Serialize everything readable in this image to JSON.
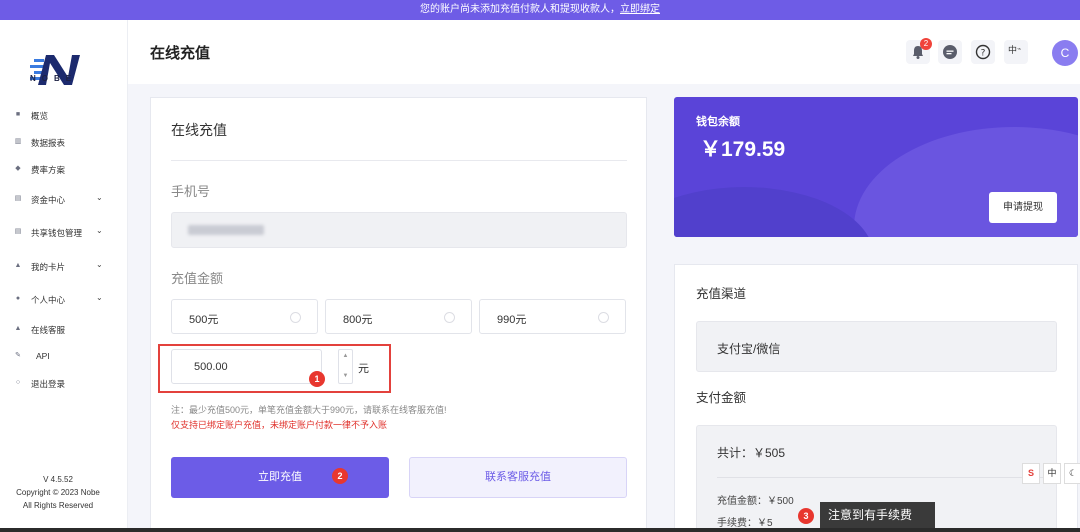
{
  "banner": {
    "text": "您的账户尚未添加充值付款人和提现收款人，",
    "link": "立即绑定"
  },
  "brand": {
    "logo_text": "NOBE"
  },
  "sidebar": {
    "items": [
      {
        "label": "概览",
        "icon": "home-icon"
      },
      {
        "label": "数据报表",
        "icon": "chart-icon"
      },
      {
        "label": "费率方案",
        "icon": "rate-icon"
      },
      {
        "label": "资金中心",
        "icon": "fund-icon",
        "expandable": true
      },
      {
        "label": "共享钱包管理",
        "icon": "wallet-icon",
        "expandable": true
      },
      {
        "label": "我的卡片",
        "icon": "card-icon",
        "expandable": true
      },
      {
        "label": "个人中心",
        "icon": "user-icon",
        "expandable": true
      },
      {
        "label": "在线客服",
        "icon": "service-icon"
      },
      {
        "label": "API",
        "icon": "api-icon"
      },
      {
        "label": "退出登录",
        "icon": "logout-icon"
      }
    ],
    "version": "V 4.5.52",
    "copyright": "Copyright © 2023 Nobe",
    "rights": "All Rights Reserved"
  },
  "header": {
    "title": "在线充值",
    "notification_count": "2",
    "language": "中",
    "avatar_initial": "C"
  },
  "recharge_form": {
    "card_title": "在线充值",
    "phone_label": "手机号",
    "amount_label": "充值金额",
    "options": [
      "500元",
      "800元",
      "990元"
    ],
    "amount_value": "500.00",
    "unit": "元",
    "note": "注：最少充值500元，单笔充值金额大于990元，请联系在线客服充值!",
    "warning": "仅支持已绑定账户充值，未绑定账户付款一律不予入账",
    "submit": "立即充值",
    "contact": "联系客服充值",
    "markers": [
      "1",
      "2",
      "3"
    ]
  },
  "wallet": {
    "label": "钱包余额",
    "amount": "￥179.59",
    "withdraw": "申请提现"
  },
  "payment": {
    "channel_title": "充值渠道",
    "channel": "支付宝/微信",
    "amount_title": "支付金额",
    "total": "共计：￥505",
    "recharge_amount": "充值金额：￥500",
    "fee": "手续费：￥5"
  },
  "tooltip": {
    "text": "注意到有手续费"
  },
  "tools": [
    "中"
  ],
  "colors": {
    "primary": "#6c5ce7",
    "danger": "#e3413c",
    "wallet": "#5a44d8"
  }
}
